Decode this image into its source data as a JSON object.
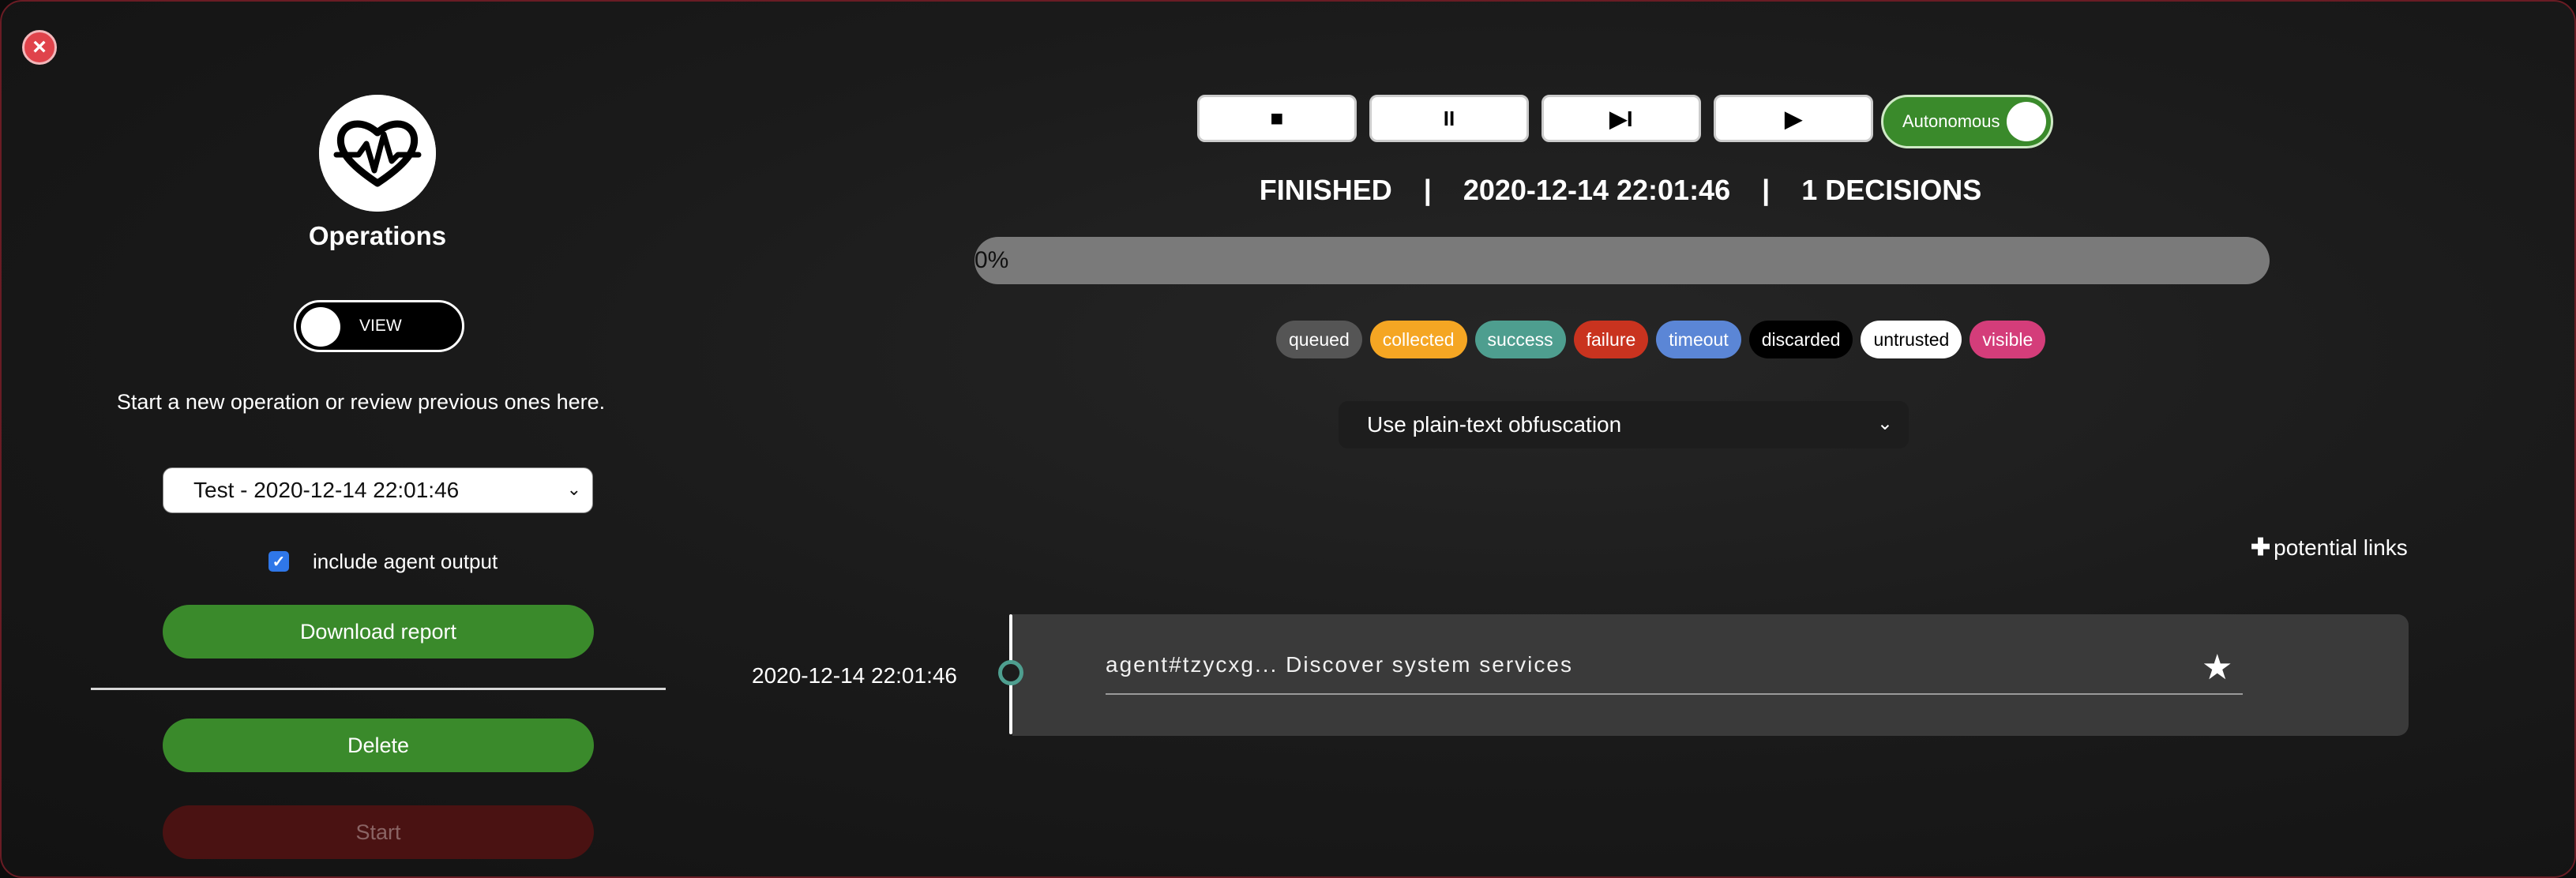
{
  "header": {
    "close_label": "×"
  },
  "sidebar": {
    "title": "Operations",
    "view_toggle_label": "VIEW",
    "intro_text": "Start a new operation or review previous ones here.",
    "operation_select_value": "Test - 2020-12-14 22:01:46",
    "include_output_label": "include agent output",
    "include_output_checked": true,
    "download_label": "Download report",
    "delete_label": "Delete",
    "start_label": "Start"
  },
  "controls": {
    "stop_icon": "■",
    "pause_icon": "II",
    "step_icon": "▶I",
    "play_icon": "▶",
    "autonomous_label": "Autonomous"
  },
  "status": {
    "state": "FINISHED",
    "separator": "|",
    "timestamp": "2020-12-14 22:01:46",
    "decisions": "1 DECISIONS"
  },
  "progress": {
    "text": "0%",
    "value": 0
  },
  "legend": [
    {
      "label": "queued",
      "bg": "#555555",
      "fg": "#ffffff"
    },
    {
      "label": "collected",
      "bg": "#f5a623",
      "fg": "#ffffff"
    },
    {
      "label": "success",
      "bg": "#4e9e8f",
      "fg": "#ffffff"
    },
    {
      "label": "failure",
      "bg": "#c9331f",
      "fg": "#ffffff"
    },
    {
      "label": "timeout",
      "bg": "#5b86d6",
      "fg": "#ffffff"
    },
    {
      "label": "discarded",
      "bg": "#000000",
      "fg": "#ffffff"
    },
    {
      "label": "untrusted",
      "bg": "#ffffff",
      "fg": "#000000"
    },
    {
      "label": "visible",
      "bg": "#d43d7a",
      "fg": "#ffffff"
    }
  ],
  "obfuscation": {
    "selected": "Use plain-text obfuscation"
  },
  "potential_links_label": "potential links",
  "timeline": [
    {
      "time": "2020-12-14 22:01:46",
      "text": "agent#tzycxg... Discover system services",
      "status_color": "#4e9e8f"
    }
  ],
  "colors": {
    "accent_green": "#3a8a2b",
    "frame_border": "#6a1c24",
    "danger": "#e0434b"
  },
  "icons": {
    "logo": "heartbeat-icon",
    "close": "close-icon",
    "favorite": "star-icon",
    "add": "plus-icon"
  }
}
